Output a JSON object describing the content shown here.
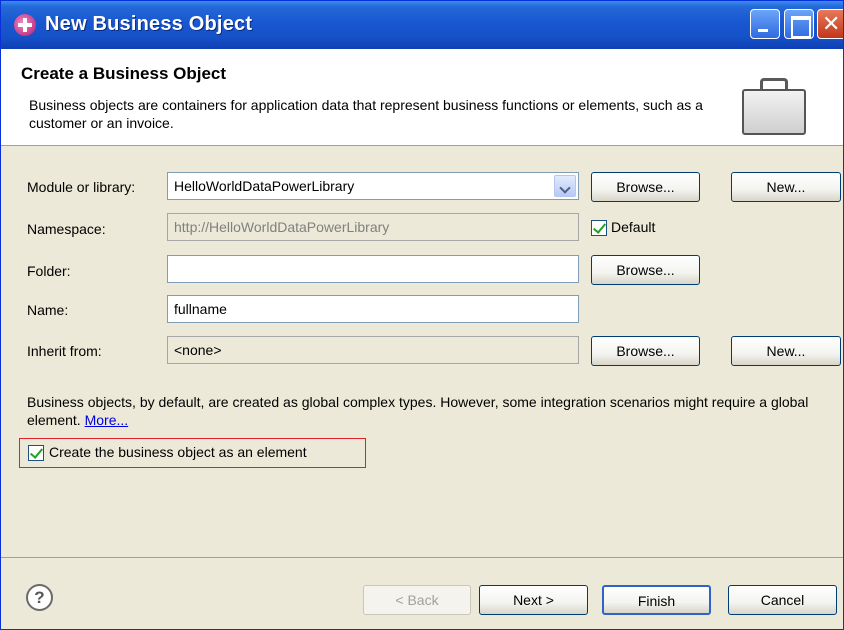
{
  "window": {
    "title": "New Business Object"
  },
  "banner": {
    "title": "Create a Business Object",
    "description": "Business objects are containers for application data that represent business functions or elements, such as a customer or an invoice."
  },
  "form": {
    "module": {
      "label": "Module or library:",
      "value": "HelloWorldDataPowerLibrary",
      "browse_label": "Browse...",
      "new_label": "New..."
    },
    "namespace": {
      "label": "Namespace:",
      "value": "http://HelloWorldDataPowerLibrary",
      "default_label": "Default",
      "default_checked": true
    },
    "folder": {
      "label": "Folder:",
      "value": "",
      "browse_label": "Browse..."
    },
    "name": {
      "label": "Name:",
      "value": "fullname"
    },
    "inherit": {
      "label": "Inherit from:",
      "value": "<none>",
      "browse_label": "Browse...",
      "new_label": "New..."
    }
  },
  "note": {
    "text": "Business objects, by default, are created as global complex types. However, some integration scenarios might require a global element.",
    "more_link": "More...",
    "checkbox_label": "Create the business object as an element",
    "checkbox_checked": true
  },
  "footer": {
    "help_icon": "?",
    "back_label": "< Back",
    "next_label": "Next >",
    "finish_label": "Finish",
    "cancel_label": "Cancel"
  },
  "colors": {
    "titlebar": "#1957d0",
    "highlight_border": "#e0202a",
    "dialog_bg": "#ece9d8"
  }
}
